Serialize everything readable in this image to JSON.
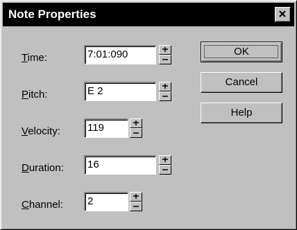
{
  "window": {
    "title": "Note Properties"
  },
  "fields": {
    "time": {
      "label_mnemonic": "T",
      "label_rest": "ime:",
      "value": "7:01:090"
    },
    "pitch": {
      "label_mnemonic": "P",
      "label_rest": "itch:",
      "value": "E 2"
    },
    "velocity": {
      "label_mnemonic": "V",
      "label_rest": "elocity:",
      "value": "119"
    },
    "duration": {
      "label_mnemonic": "D",
      "label_rest": "uration:",
      "value": "16"
    },
    "channel": {
      "label_mnemonic": "C",
      "label_rest": "hannel:",
      "value": "2"
    }
  },
  "buttons": {
    "ok": "OK",
    "cancel": "Cancel",
    "help": "Help"
  },
  "icons": {
    "close": "close-icon",
    "spinner_up": "spinner-up-icon",
    "spinner_down": "spinner-down-icon"
  }
}
